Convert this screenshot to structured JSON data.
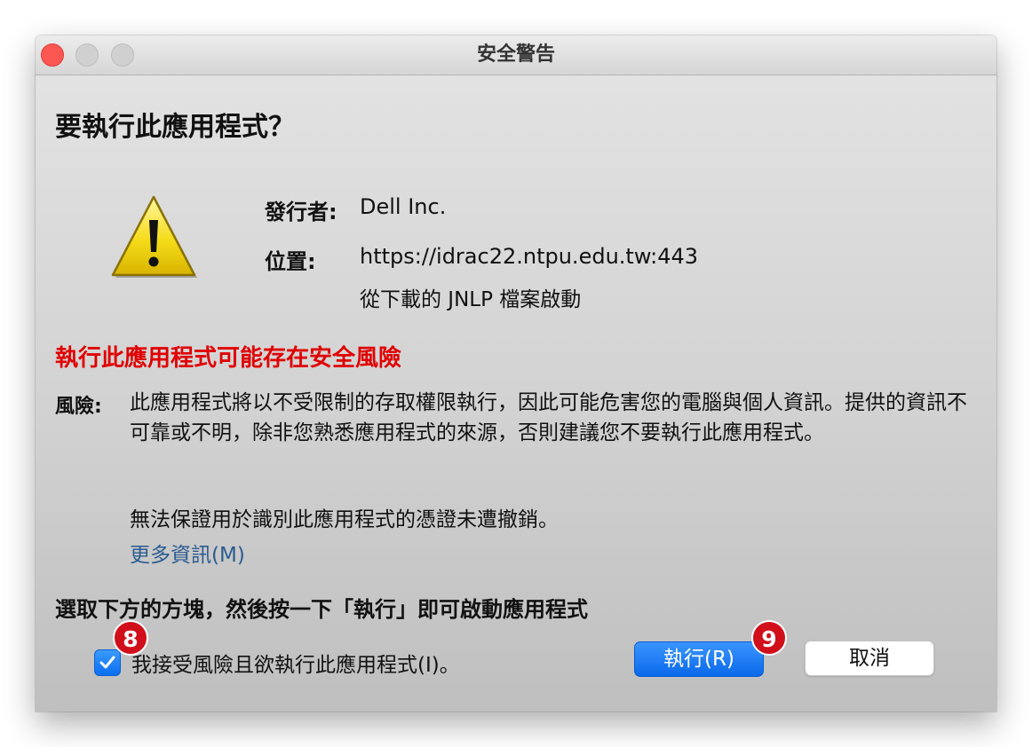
{
  "window": {
    "title": "安全警告"
  },
  "heading": "要執行此應用程式？",
  "publisher": {
    "label": "發行者:",
    "value": "Dell Inc."
  },
  "location": {
    "label": "位置:",
    "url": "https://idrac22.ntpu.edu.tw:443",
    "note": "從下載的 JNLP 檔案啟動"
  },
  "risk_title": "執行此應用程式可能存在安全風險",
  "risk": {
    "label": "風險:",
    "text": "此應用程式將以不受限制的存取權限執行，因此可能危害您的電腦與個人資訊。提供的資訊不可靠或不明，除非您熟悉應用程式的來源，否則建議您不要執行此應用程式。",
    "cert_note": "無法保證用於識別此應用程式的憑證未遭撤銷。",
    "more_info": "更多資訊(M)"
  },
  "instruction": "選取下方的方塊，然後按一下「執行」即可啟動應用程式",
  "accept_checkbox": {
    "label": "我接受風險且欲執行此應用程式(I)。",
    "checked": true
  },
  "buttons": {
    "run": "執行(R)",
    "cancel": "取消"
  },
  "annotations": {
    "badge_8": "8",
    "badge_9": "9"
  },
  "colors": {
    "risk_title": "#e00000",
    "primary_button": "#0a6ef0",
    "badge": "#d10f1a",
    "link": "#2b5c91"
  },
  "icons": [
    "warning-icon",
    "checkmark-icon"
  ]
}
